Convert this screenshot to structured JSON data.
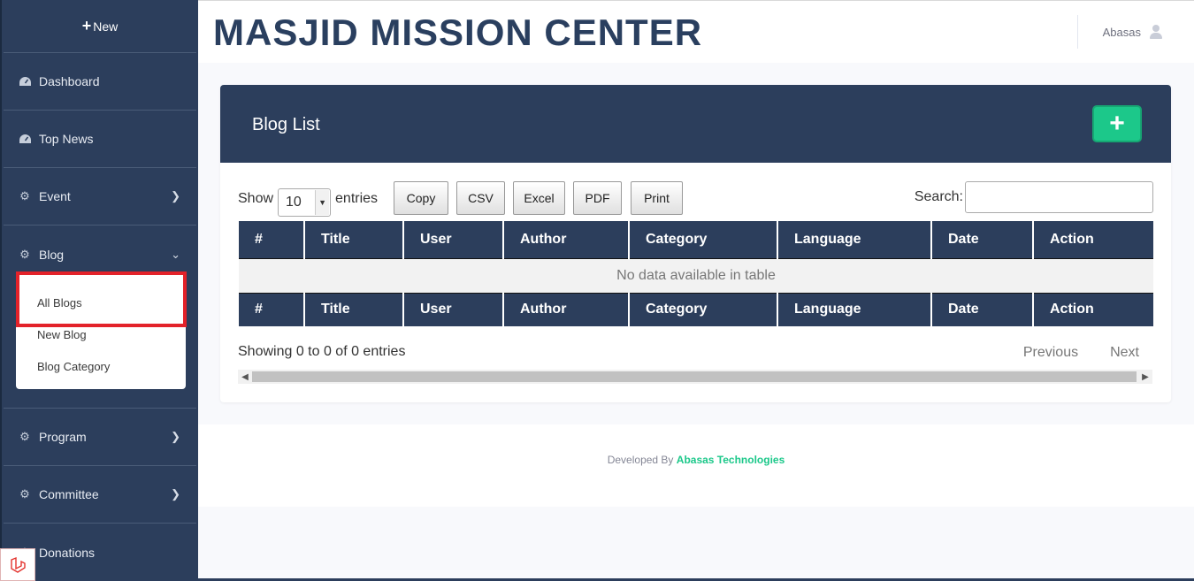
{
  "sidebar": {
    "new_label": "New",
    "items": [
      {
        "label": "Dashboard",
        "icon": "dashboard-icon"
      },
      {
        "label": "Top News",
        "icon": "dashboard-icon"
      },
      {
        "label": "Event",
        "icon": "gear-icon"
      },
      {
        "label": "Blog",
        "icon": "gear-icon"
      },
      {
        "label": "Program",
        "icon": "gear-icon"
      },
      {
        "label": "Committee",
        "icon": "gear-icon"
      },
      {
        "label": "Donations",
        "icon": "gear-icon"
      }
    ],
    "blog_submenu": [
      "All Blogs",
      "New Blog",
      "Blog Category"
    ]
  },
  "header": {
    "brand": "MASJID MISSION CENTER",
    "user_name": "Abasas"
  },
  "card": {
    "title": "Blog List",
    "show_label": "Show",
    "entries_label": "entries",
    "page_length": "10",
    "buttons": [
      "Copy",
      "CSV",
      "Excel",
      "PDF",
      "Print"
    ],
    "search_label": "Search:",
    "search_value": "",
    "columns": [
      "#",
      "Title",
      "User",
      "Author",
      "Category",
      "Language",
      "Date",
      "Action"
    ],
    "empty_message": "No data available in table",
    "info": "Showing 0 to 0 of 0 entries",
    "prev_label": "Previous",
    "next_label": "Next"
  },
  "footer": {
    "prefix": "Developed By",
    "company": "Abasas Technologies"
  },
  "colors": {
    "sidebar": "#2c3e5c",
    "accent_green": "#1cc88a",
    "highlight_red": "#e3222a"
  }
}
